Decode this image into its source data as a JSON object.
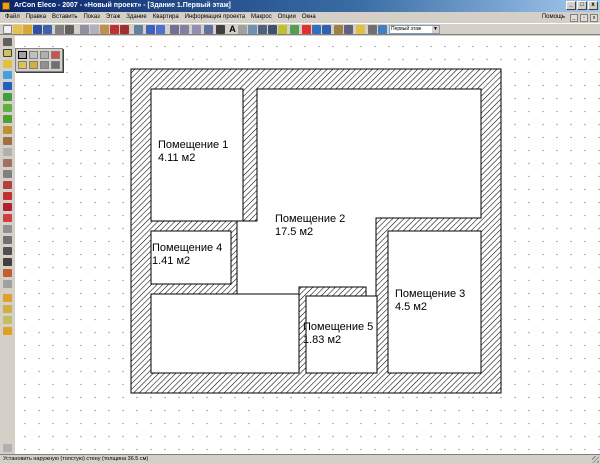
{
  "window": {
    "title": "ArCon Eleco - 2007 - «Новый проект» - [Здание 1.Первый этаж]",
    "minimize": "_",
    "maximize": "□",
    "close": "x"
  },
  "menu": {
    "items": [
      "Файл",
      "Правка",
      "Вставить",
      "Показ",
      "Этаж",
      "Здание",
      "Квартира",
      "Информация проекта",
      "Макрос",
      "Опции",
      "Окна"
    ],
    "help": "Помощь"
  },
  "toolbar": {
    "floor_select": "Первый этаж"
  },
  "rooms": [
    {
      "name": "Помещение 1",
      "area": "4.11 м2"
    },
    {
      "name": "Помещение 2",
      "area": "17.5 м2"
    },
    {
      "name": "Помещение 3",
      "area": "4.5 м2"
    },
    {
      "name": "Помещение 4",
      "area": "1.41 м2"
    },
    {
      "name": "Помещение 5",
      "area": "1.83 м2"
    }
  ],
  "status": {
    "text": "Установить наружную (толстую) стену (толщина 36.5 см)"
  },
  "colors": {
    "title_start": "#0a246a",
    "title_end": "#a6caf0",
    "chrome": "#d4d0c8",
    "wall_hatch": "#000000"
  }
}
